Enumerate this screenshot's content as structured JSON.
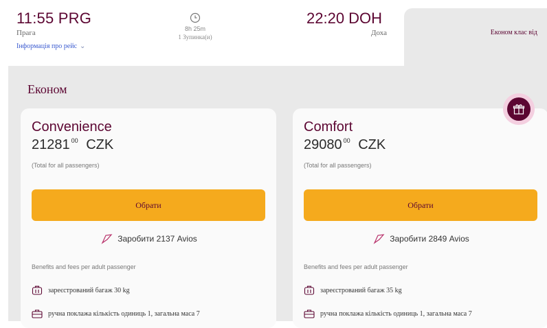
{
  "departure": {
    "time": "11:55 PRG",
    "city": "Прага",
    "flight_info_link": "Інформація про рейс"
  },
  "duration": {
    "time": "8h 25m",
    "stops": "1 Зупинка(и)"
  },
  "arrival": {
    "time": "22:20 DOH",
    "city": "Доха"
  },
  "class_tab": {
    "label": "Економ клас від"
  },
  "cabin": {
    "title": "Економ"
  },
  "fares": [
    {
      "name": "Convenience",
      "price_main": "21281",
      "price_fraction": "00",
      "currency": "CZK",
      "note": "(Total for all passengers)",
      "select_label": "Обрати",
      "avios": "Заробити 2137 Avios",
      "benefits_title": "Benefits and fees per adult passenger",
      "benefit_checked_bag": "зареєстрований багаж 30 kg",
      "benefit_cabin_bag": "ручна поклажа кількість одиниць 1, загальна маса 7"
    },
    {
      "name": "Comfort",
      "price_main": "29080",
      "price_fraction": "00",
      "currency": "CZK",
      "note": "(Total for all passengers)",
      "select_label": "Обрати",
      "avios": "Заробити 2849 Avios",
      "benefits_title": "Benefits and fees per adult passenger",
      "benefit_checked_bag": "зареєстрований багаж 35 kg",
      "benefit_cabin_bag": "ручна поклажа кількість одиниць 1, загальна маса 7"
    }
  ],
  "colors": {
    "brand": "#5c0632",
    "button": "#f5aa1d",
    "panel": "#e9e9e9"
  },
  "icons": [
    "clock-icon",
    "chevron-down-icon",
    "avios-tag-icon",
    "checked-bag-icon",
    "cabin-bag-icon",
    "gift-icon"
  ]
}
